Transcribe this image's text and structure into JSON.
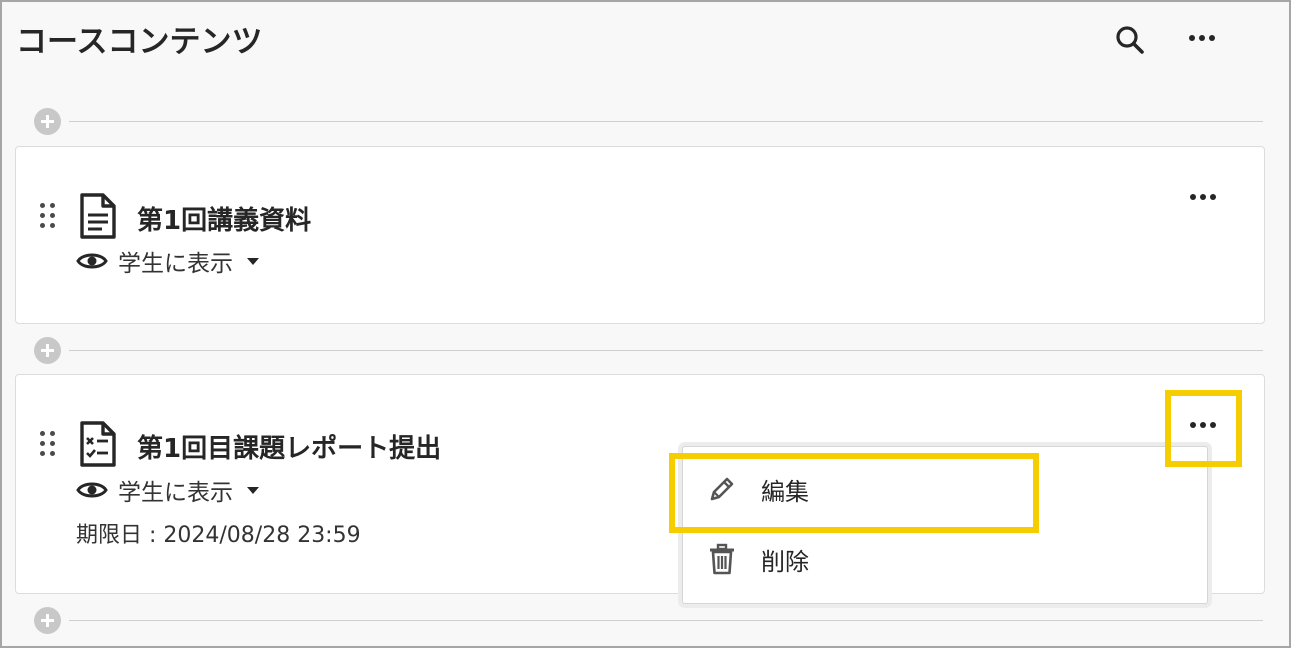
{
  "header": {
    "title": "コースコンテンツ",
    "search_icon": "search-icon",
    "more_icon": "more-horizontal-icon"
  },
  "items": [
    {
      "title": "第1回講義資料",
      "icon": "document-icon",
      "visibility": "学生に表示"
    },
    {
      "title": "第1回目課題レポート提出",
      "icon": "assignment-icon",
      "visibility": "学生に表示",
      "due": "期限日 : 2024/08/28 23:59"
    }
  ],
  "context_menu": {
    "items": [
      {
        "label": "編集",
        "icon": "pencil-icon"
      },
      {
        "label": "削除",
        "icon": "trash-icon"
      }
    ]
  },
  "colors": {
    "highlight": "#f5cd00",
    "text": "#262626",
    "background": "#f8f8f8"
  }
}
